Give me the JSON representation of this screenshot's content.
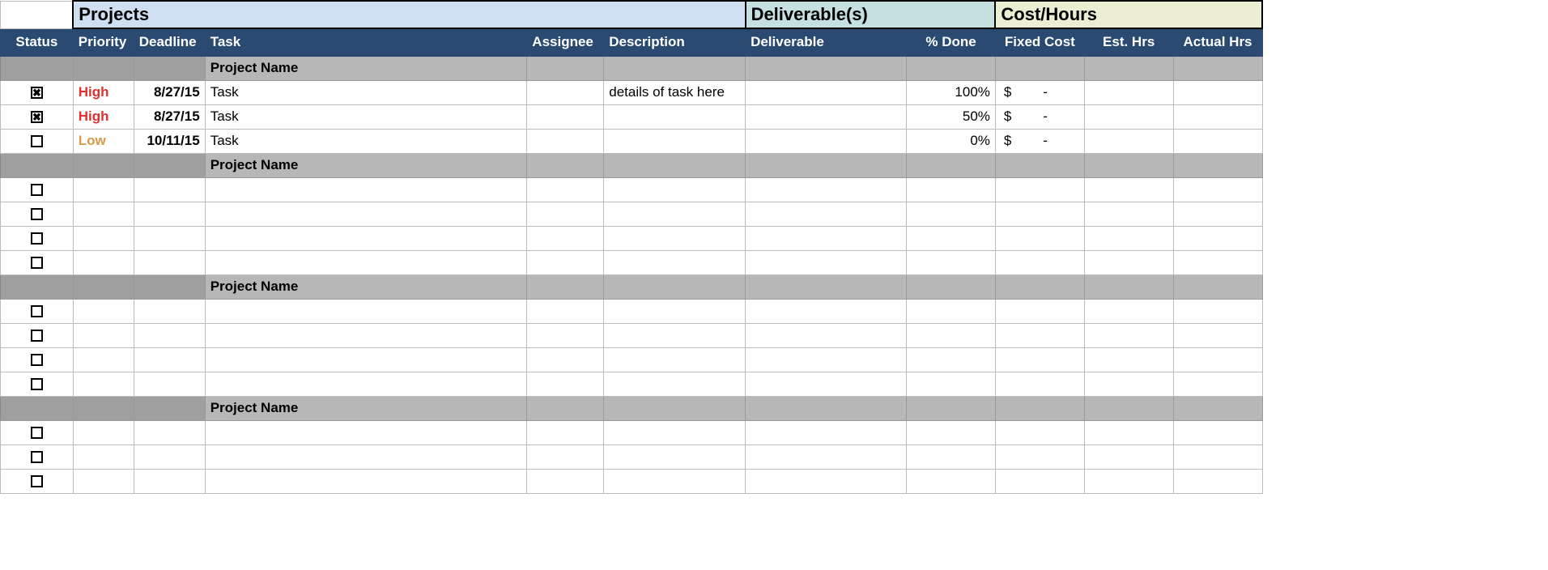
{
  "sections": {
    "projects": "Projects",
    "deliverables": "Deliverable(s)",
    "cost": "Cost/Hours"
  },
  "columns": {
    "status": "Status",
    "priority": "Priority",
    "deadline": "Deadline",
    "task": "Task",
    "assignee": "Assignee",
    "description": "Description",
    "deliverable": "Deliverable",
    "pct_done": "% Done",
    "fixed_cost": "Fixed Cost",
    "est_hrs": "Est. Hrs",
    "actual_hrs": "Actual Hrs"
  },
  "groups": [
    {
      "name": "Project Name",
      "rows": [
        {
          "checked": true,
          "priority": "High",
          "priority_class": "prio-high",
          "deadline": "8/27/15",
          "task": "Task",
          "assignee": "",
          "description": "details of task here",
          "deliverable": "",
          "pct_done": "100%",
          "cost_symbol": "$",
          "cost_value": "-",
          "est": "",
          "act": ""
        },
        {
          "checked": true,
          "priority": "High",
          "priority_class": "prio-high",
          "deadline": "8/27/15",
          "task": "Task",
          "assignee": "",
          "description": "",
          "deliverable": "",
          "pct_done": "50%",
          "cost_symbol": "$",
          "cost_value": "-",
          "est": "",
          "act": ""
        },
        {
          "checked": false,
          "priority": "Low",
          "priority_class": "prio-low",
          "deadline": "10/11/15",
          "task": "Task",
          "assignee": "",
          "description": "",
          "deliverable": "",
          "pct_done": "0%",
          "cost_symbol": "$",
          "cost_value": "-",
          "est": "",
          "act": ""
        }
      ]
    },
    {
      "name": "Project Name",
      "rows": [
        {
          "checked": false,
          "priority": "",
          "priority_class": "",
          "deadline": "",
          "task": "",
          "assignee": "",
          "description": "",
          "deliverable": "",
          "pct_done": "",
          "cost_symbol": "",
          "cost_value": "",
          "est": "",
          "act": ""
        },
        {
          "checked": false,
          "priority": "",
          "priority_class": "",
          "deadline": "",
          "task": "",
          "assignee": "",
          "description": "",
          "deliverable": "",
          "pct_done": "",
          "cost_symbol": "",
          "cost_value": "",
          "est": "",
          "act": ""
        },
        {
          "checked": false,
          "priority": "",
          "priority_class": "",
          "deadline": "",
          "task": "",
          "assignee": "",
          "description": "",
          "deliverable": "",
          "pct_done": "",
          "cost_symbol": "",
          "cost_value": "",
          "est": "",
          "act": ""
        },
        {
          "checked": false,
          "priority": "",
          "priority_class": "",
          "deadline": "",
          "task": "",
          "assignee": "",
          "description": "",
          "deliverable": "",
          "pct_done": "",
          "cost_symbol": "",
          "cost_value": "",
          "est": "",
          "act": ""
        }
      ]
    },
    {
      "name": "Project Name",
      "rows": [
        {
          "checked": false,
          "priority": "",
          "priority_class": "",
          "deadline": "",
          "task": "",
          "assignee": "",
          "description": "",
          "deliverable": "",
          "pct_done": "",
          "cost_symbol": "",
          "cost_value": "",
          "est": "",
          "act": ""
        },
        {
          "checked": false,
          "priority": "",
          "priority_class": "",
          "deadline": "",
          "task": "",
          "assignee": "",
          "description": "",
          "deliverable": "",
          "pct_done": "",
          "cost_symbol": "",
          "cost_value": "",
          "est": "",
          "act": ""
        },
        {
          "checked": false,
          "priority": "",
          "priority_class": "",
          "deadline": "",
          "task": "",
          "assignee": "",
          "description": "",
          "deliverable": "",
          "pct_done": "",
          "cost_symbol": "",
          "cost_value": "",
          "est": "",
          "act": ""
        },
        {
          "checked": false,
          "priority": "",
          "priority_class": "",
          "deadline": "",
          "task": "",
          "assignee": "",
          "description": "",
          "deliverable": "",
          "pct_done": "",
          "cost_symbol": "",
          "cost_value": "",
          "est": "",
          "act": ""
        }
      ]
    },
    {
      "name": "Project Name",
      "rows": [
        {
          "checked": false,
          "priority": "",
          "priority_class": "",
          "deadline": "",
          "task": "",
          "assignee": "",
          "description": "",
          "deliverable": "",
          "pct_done": "",
          "cost_symbol": "",
          "cost_value": "",
          "est": "",
          "act": ""
        },
        {
          "checked": false,
          "priority": "",
          "priority_class": "",
          "deadline": "",
          "task": "",
          "assignee": "",
          "description": "",
          "deliverable": "",
          "pct_done": "",
          "cost_symbol": "",
          "cost_value": "",
          "est": "",
          "act": ""
        },
        {
          "checked": false,
          "priority": "",
          "priority_class": "",
          "deadline": "",
          "task": "",
          "assignee": "",
          "description": "",
          "deliverable": "",
          "pct_done": "",
          "cost_symbol": "",
          "cost_value": "",
          "est": "",
          "act": ""
        }
      ]
    }
  ],
  "glyphs": {
    "checked": "✖",
    "unchecked": ""
  }
}
